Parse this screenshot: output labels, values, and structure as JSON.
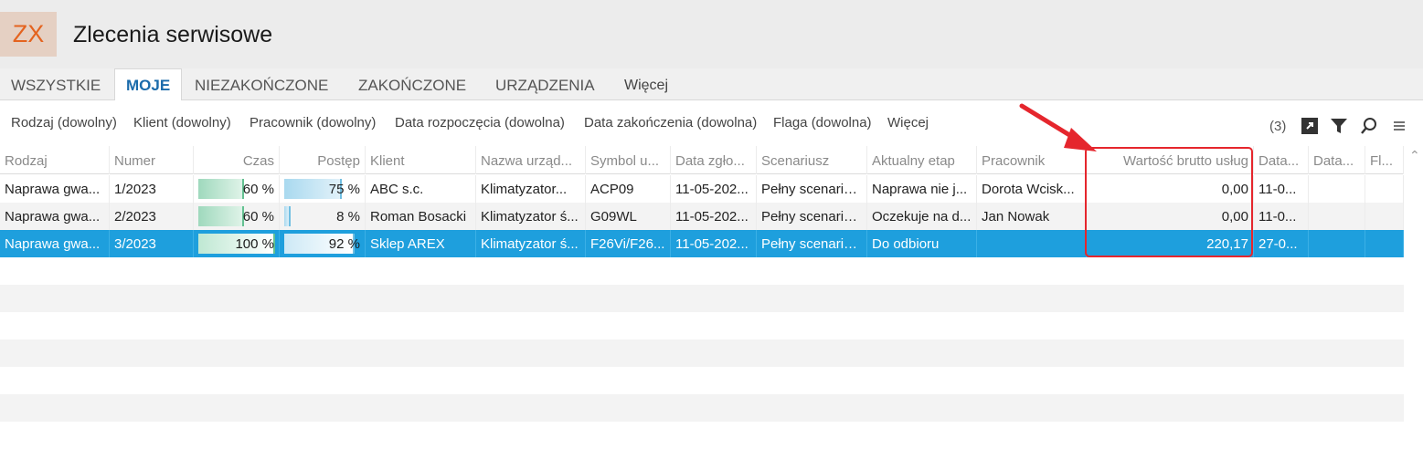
{
  "app": {
    "logo_text": "ZX",
    "title": "Zlecenia serwisowe",
    "logo_color": "#e4631f",
    "accent": "#1e9fdd"
  },
  "tabs": [
    {
      "label": "WSZYSTKIE",
      "active": false
    },
    {
      "label": "MOJE",
      "active": true
    },
    {
      "label": "NIEZAKOŃCZONE",
      "active": false
    },
    {
      "label": "ZAKOŃCZONE",
      "active": false
    },
    {
      "label": "URZĄDZENIA",
      "active": false
    },
    {
      "label": "Więcej",
      "active": false
    }
  ],
  "filters": [
    "Rodzaj (dowolny)",
    "Klient (dowolny)",
    "Pracownik (dowolny)",
    "Data rozpoczęcia (dowolna)",
    "Data zakończenia (dowolna)",
    "Flaga (dowolna)",
    "Więcej"
  ],
  "toolbar": {
    "count": "(3)",
    "icons": [
      "export-icon",
      "filter-icon",
      "search-icon",
      "menu-icon"
    ]
  },
  "columns": [
    "Rodzaj",
    "Numer",
    "Czas",
    "Postęp",
    "Klient",
    "Nazwa urząd...",
    "Symbol u...",
    "Data zgło...",
    "Scenariusz",
    "Aktualny etap",
    "Pracownik",
    "Wartość brutto usług",
    "Data...",
    "Data...",
    "Fl..."
  ],
  "rows": [
    {
      "rodzaj": "Naprawa gwa...",
      "numer": "1/2023",
      "czas": "60 %",
      "czas_value": 0.6,
      "postep": "75 %",
      "postep_value": 0.75,
      "klient": "ABC s.c.",
      "nazwa": "Klimatyzator...",
      "symbol": "ACP09",
      "data_zgl": "11-05-202...",
      "scenariusz": "Pełny scenariu...",
      "etap": "Naprawa nie j...",
      "pracownik": "Dorota Wcisk...",
      "wartosc": "0,00",
      "data1": "11-0...",
      "data2": "",
      "flaga": "",
      "selected": false
    },
    {
      "rodzaj": "Naprawa gwa...",
      "numer": "2/2023",
      "czas": "60 %",
      "czas_value": 0.6,
      "postep": "8 %",
      "postep_value": 0.08,
      "klient": "Roman Bosacki",
      "nazwa": "Klimatyzator ś...",
      "symbol": "G09WL",
      "data_zgl": "11-05-202...",
      "scenariusz": "Pełny scenariu...",
      "etap": "Oczekuje na d...",
      "pracownik": "Jan Nowak",
      "wartosc": "0,00",
      "data1": "11-0...",
      "data2": "",
      "flaga": "",
      "selected": false
    },
    {
      "rodzaj": "Naprawa gwa...",
      "numer": "3/2023",
      "czas": "100 %",
      "czas_value": 1.0,
      "postep": "92 %",
      "postep_value": 0.92,
      "klient": "Sklep AREX",
      "nazwa": "Klimatyzator ś...",
      "symbol": "F26Vi/F26...",
      "data_zgl": "11-05-202...",
      "scenariusz": "Pełny scenariu...",
      "etap": "Do odbioru",
      "pracownik": "",
      "wartosc": "220,17",
      "data1": "27-0...",
      "data2": "",
      "flaga": "",
      "selected": true
    }
  ]
}
